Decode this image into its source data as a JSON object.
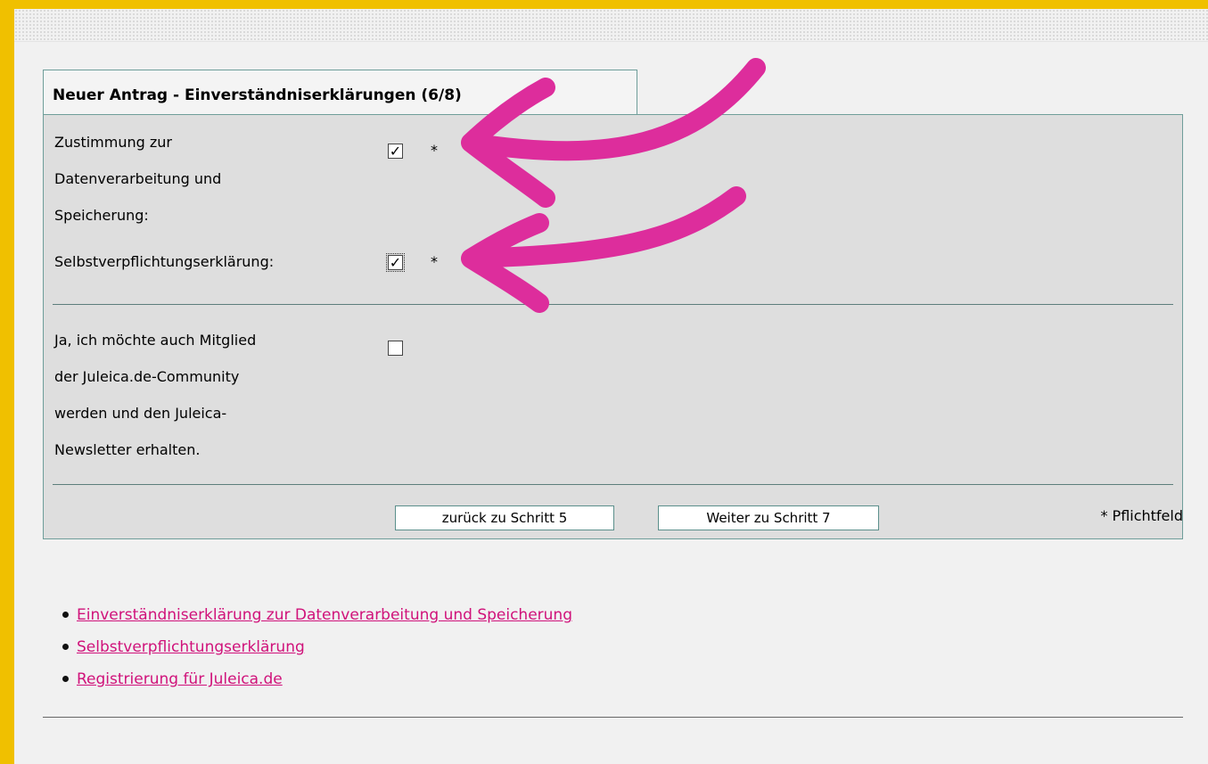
{
  "form": {
    "title": "Neuer Antrag - Einverständniserklärungen (6/8)",
    "fields": [
      {
        "label_lines": [
          "Zustimmung zur",
          "Datenverarbeitung und",
          "Speicherung:"
        ],
        "checked": true,
        "required_mark": "*"
      },
      {
        "label_lines": [
          "Selbstverpflichtungserklärung:"
        ],
        "checked": true,
        "required_mark": "*"
      },
      {
        "label_lines": [
          "Ja, ich möchte auch Mitglied",
          "der Juleica.de-Community",
          "werden und den Juleica-",
          "Newsletter erhalten."
        ],
        "checked": false,
        "required_mark": ""
      }
    ],
    "checkmark": "✓",
    "back_button": "zurück zu Schritt 5",
    "next_button": "Weiter zu Schritt 7",
    "required_note": "* Pflichtfeld"
  },
  "links": [
    "Einverständniserklärung zur Datenverarbeitung und Speicherung",
    "Selbstverpflichtungserklärung",
    "Registrierung für Juleica.de"
  ],
  "colors": {
    "outer_background": "#f0c000",
    "panel_border": "#6f9e9a",
    "link": "#d0127a",
    "annotation_arrow": "#dd2d9c"
  }
}
